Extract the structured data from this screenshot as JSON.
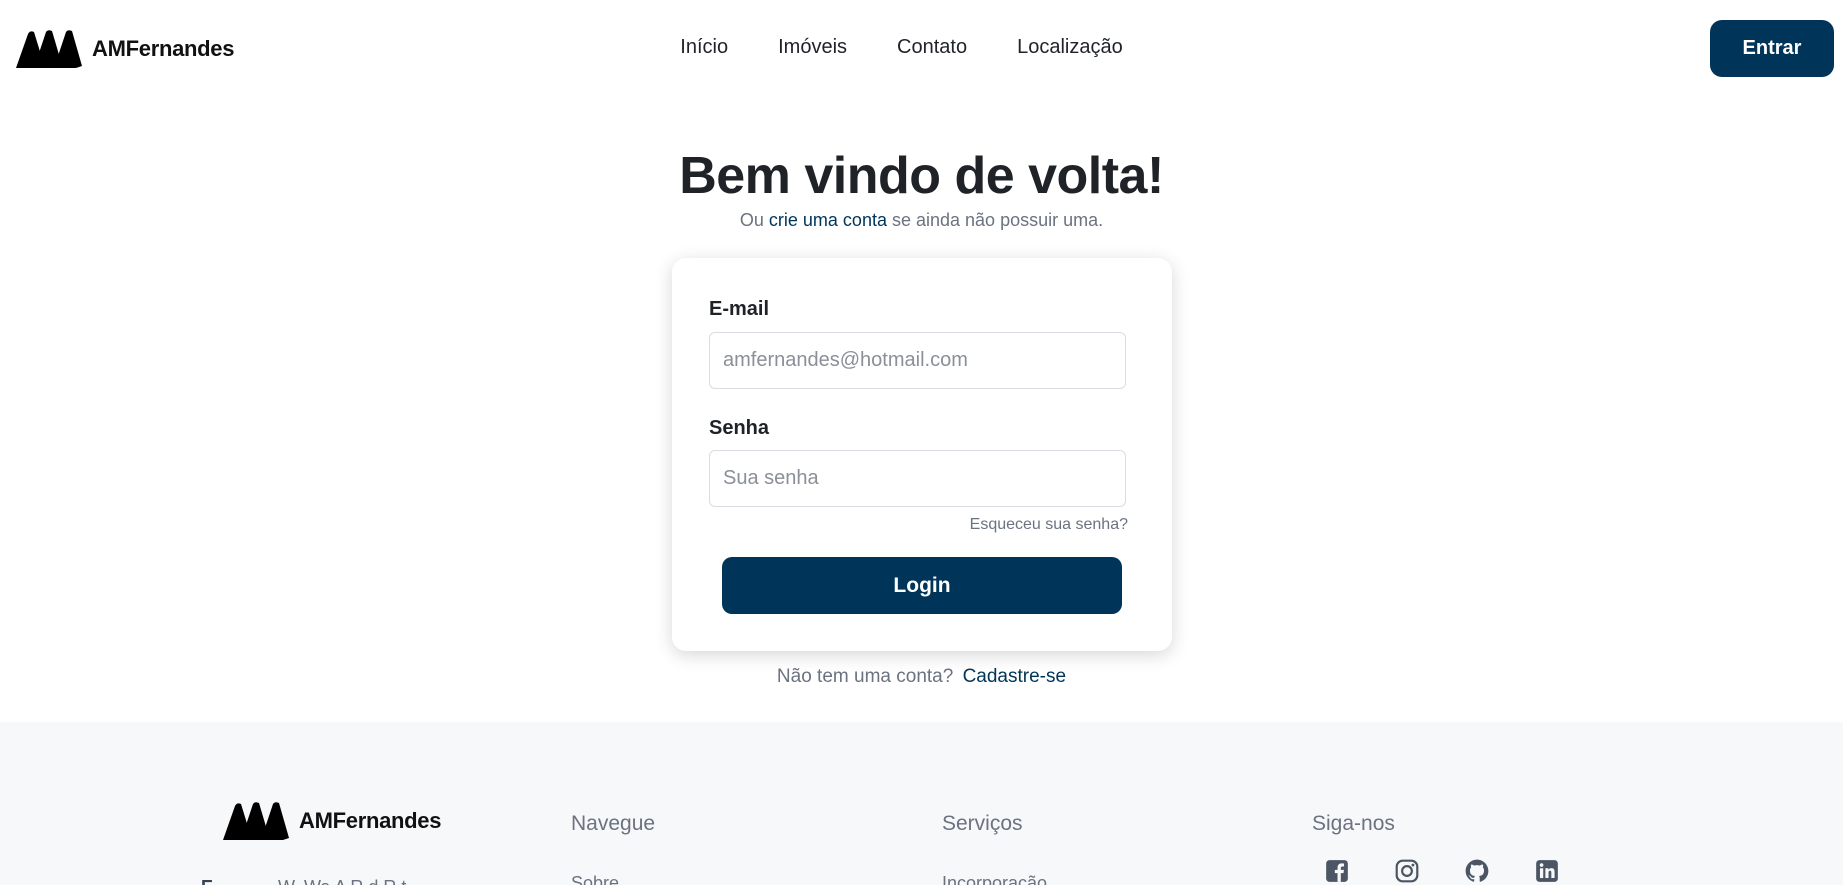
{
  "header": {
    "brand": "AMFernandes",
    "nav": [
      "Início",
      "Imóveis",
      "Contato",
      "Localização"
    ],
    "login_button": "Entrar"
  },
  "main": {
    "title": "Bem vindo de volta!",
    "subtitle_prefix": "Ou",
    "subtitle_link": "crie uma conta",
    "subtitle_suffix": "se ainda não possuir uma.",
    "form": {
      "email_label": "E-mail",
      "email_placeholder": "amfernandes@hotmail.com",
      "password_label": "Senha",
      "password_placeholder": "Sua senha",
      "forgot": "Esqueceu sua senha?",
      "submit": "Login"
    },
    "no_account": "Não tem uma conta?",
    "signup_link": "Cadastre-se"
  },
  "footer": {
    "brand": "AMFernandes",
    "address_visible": "W. Wa  A  R   d  R    t",
    "address_label": "E",
    "columns": [
      {
        "heading": "Navegue",
        "first_link": "Sobre"
      },
      {
        "heading": "Serviços",
        "first_link": "Incorporação"
      },
      {
        "heading": "Siga-nos"
      }
    ],
    "social_icons": [
      "facebook-icon",
      "instagram-icon",
      "github-icon",
      "linkedin-icon"
    ]
  },
  "colors": {
    "primary": "#003459",
    "text": "#1f2328",
    "muted": "#6b7280",
    "footer_bg": "#f7f8fa"
  }
}
